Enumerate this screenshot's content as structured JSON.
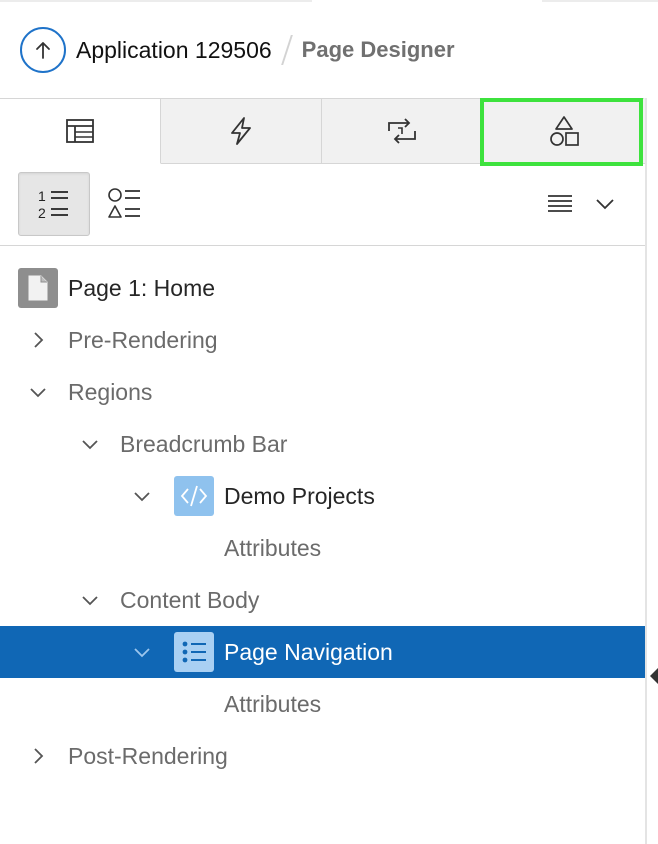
{
  "header": {
    "app_title": "Application 129506",
    "page_title": "Page Designer",
    "up_icon": "arrow-up-circle-icon",
    "accent_color": "#1f73c9"
  },
  "tabs": [
    {
      "icon": "rendering-tree-icon",
      "active": true
    },
    {
      "icon": "lightning-bolt-icon",
      "active": false
    },
    {
      "icon": "processing-arrows-icon",
      "active": false
    },
    {
      "icon": "shared-components-shapes-icon",
      "active": false,
      "highlighted": true
    }
  ],
  "toolbar": {
    "group_by_component_type_icon": "numbered-list-icon",
    "group_by_processing_order_icon": "shapes-list-icon",
    "menu_icon": "menu-lines-icon",
    "menu_chevron_icon": "chevron-down-icon"
  },
  "tree": {
    "root_label": "Page 1: Home",
    "pre_rendering": "Pre-Rendering",
    "regions": "Regions",
    "breadcrumb_bar": "Breadcrumb Bar",
    "demo_projects": "Demo Projects",
    "attributes_1": "Attributes",
    "content_body": "Content Body",
    "page_navigation": "Page Navigation",
    "attributes_2": "Attributes",
    "post_rendering": "Post-Rendering",
    "selected_color": "#1067b5",
    "highlight_color": "#3de23d"
  }
}
